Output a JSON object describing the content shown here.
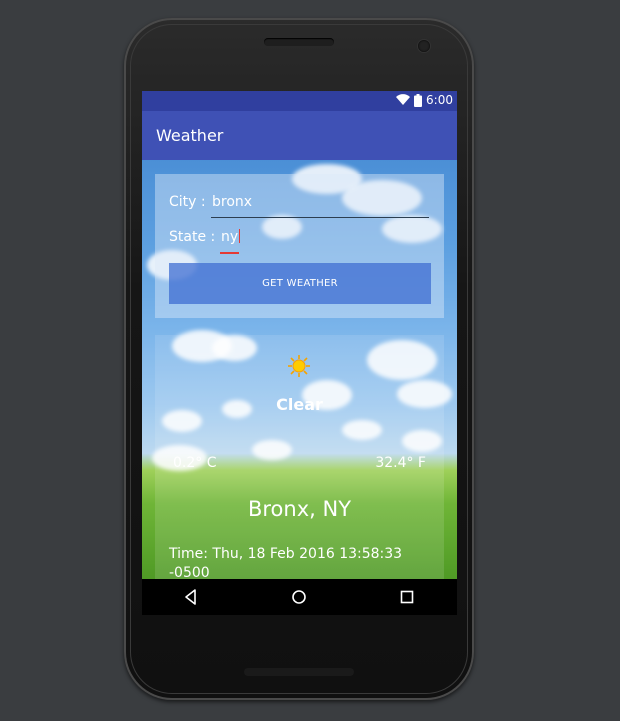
{
  "status_bar": {
    "time": "6:00",
    "icons": [
      "wifi-icon",
      "battery-icon"
    ]
  },
  "app_bar": {
    "title": "Weather"
  },
  "form": {
    "city_label": "City :",
    "city_value": "bronx",
    "state_label": "State :",
    "state_value": "ny",
    "button_label": "GET WEATHER"
  },
  "weather": {
    "icon": "sun-icon",
    "condition": "Clear",
    "temp_min": "0.2° C",
    "temp_max": "32.4° F",
    "location": "Bronx, NY",
    "time_text": "Time: Thu, 18 Feb 2016 13:58:33 -0500"
  },
  "nav_bar": {
    "icons": [
      "back-icon",
      "home-icon",
      "recents-icon"
    ]
  },
  "colors": {
    "primary": "#3f51b5",
    "primary_dark": "#303f9f",
    "accent_underline": "#e53935",
    "button": "#3f6ed2"
  }
}
